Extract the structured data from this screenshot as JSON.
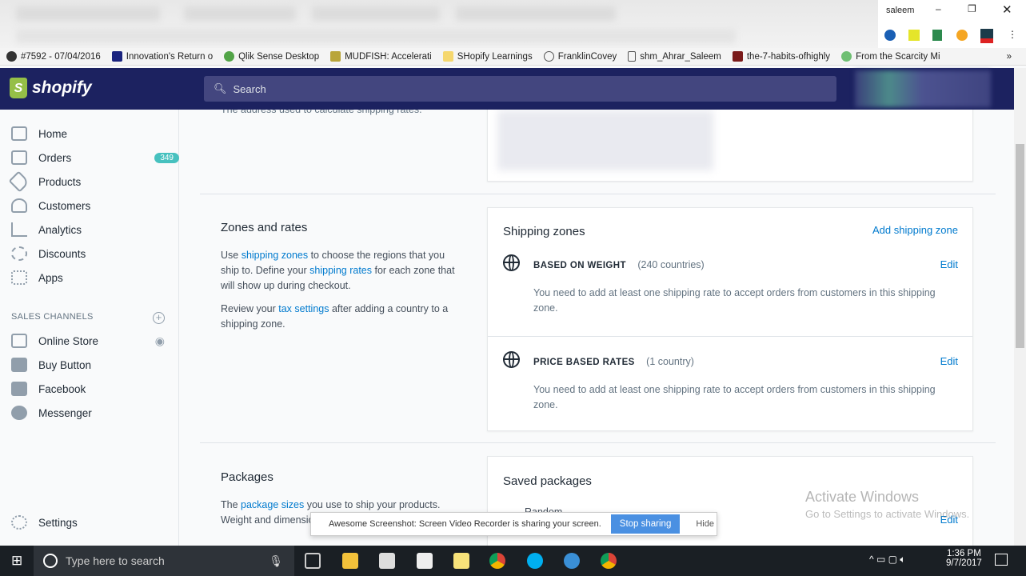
{
  "browser": {
    "user": "saleem",
    "bookmarks": [
      "#7592 - 07/04/2016",
      "Innovation's Return o",
      "Qlik Sense Desktop",
      "MUDFISH: Accelerati",
      "SHopify Learnings",
      "FranklinCovey",
      "shm_Ahrar_Saleem",
      "the-7-habits-ofhighly",
      "From the Scarcity Mi"
    ],
    "more": "»"
  },
  "header": {
    "logo": "shopify",
    "search_placeholder": "Search"
  },
  "sidebar": {
    "items": [
      {
        "label": "Home"
      },
      {
        "label": "Orders",
        "badge": "349"
      },
      {
        "label": "Products"
      },
      {
        "label": "Customers"
      },
      {
        "label": "Analytics"
      },
      {
        "label": "Discounts"
      },
      {
        "label": "Apps"
      }
    ],
    "sales_channels_title": "SALES CHANNELS",
    "channels": [
      {
        "label": "Online Store"
      },
      {
        "label": "Buy Button"
      },
      {
        "label": "Facebook"
      },
      {
        "label": "Messenger"
      }
    ],
    "settings": "Settings"
  },
  "origin": {
    "desc": "The address used to calculate shipping rates."
  },
  "zones": {
    "title": "Zones and rates",
    "p1_a": "Use ",
    "p1_link1": "shipping zones",
    "p1_b": " to choose the regions that you ship to. Define your ",
    "p1_link2": "shipping rates",
    "p1_c": " for each zone that will show up during checkout.",
    "p2_a": "Review your ",
    "p2_link": "tax settings",
    "p2_b": " after adding a country to a shipping zone.",
    "card_title": "Shipping zones",
    "add": "Add shipping zone",
    "list": [
      {
        "name": "BASED ON WEIGHT",
        "count": "(240 countries)",
        "edit": "Edit",
        "note": "You need to add at least one shipping rate to accept orders from customers in this shipping zone."
      },
      {
        "name": "PRICE BASED RATES",
        "count": "(1 country)",
        "edit": "Edit",
        "note": "You need to add at least one shipping rate to accept orders from customers in this shipping zone."
      }
    ]
  },
  "packages": {
    "title": "Packages",
    "p_a": "The ",
    "p_link": "package sizes",
    "p_b": " you use to ship your products.",
    "p2": "Weight and dimensions",
    "card_title": "Saved packages",
    "item": "Random",
    "edit": "Edit"
  },
  "share_bar": {
    "text": "Awesome Screenshot: Screen Video Recorder is sharing your screen.",
    "stop": "Stop sharing",
    "hide": "Hide"
  },
  "watermark": {
    "line1": "Activate Windows",
    "line2": "Go to Settings to activate Windows."
  },
  "taskbar": {
    "search": "Type here to search",
    "time": "1:36 PM",
    "date": "9/7/2017"
  }
}
